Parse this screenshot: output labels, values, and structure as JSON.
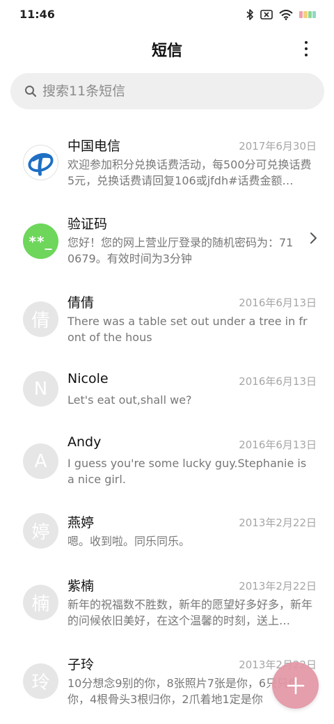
{
  "status_bar": {
    "time": "11:46",
    "icons": [
      "bluetooth-icon",
      "no-sim-icon",
      "wifi-icon",
      "battery-icon"
    ],
    "battery_colors": [
      "#f0a0a8",
      "#f2d080",
      "#8ed88a",
      "#8ed8c8"
    ]
  },
  "header": {
    "title": "短信",
    "more_icon": "more-vertical-icon"
  },
  "search": {
    "placeholder": "搜索11条短信",
    "icon": "search-icon"
  },
  "messages": [
    {
      "sender": "中国电信",
      "date": "2017年6月30日",
      "preview": "欢迎参加积分兑换话费活动，每500分可兑换话费5元，兑换话费请回复106或jfdh#话费金额…",
      "avatar_type": "logo",
      "avatar_icon": "china-telecom-logo-icon"
    },
    {
      "sender": "验证码",
      "date": "",
      "preview": "您好！您的网上营业厅登录的随机密码为：710679。有效时间为3分钟",
      "avatar_type": "code",
      "avatar_text": "**_",
      "avatar_color": "#6dd65b"
    },
    {
      "sender": "倩倩",
      "date": "2016年6月13日",
      "preview": "There was a table set out under a tree in front of the hous",
      "avatar_type": "letter",
      "avatar_text": "倩"
    },
    {
      "sender": "Nicole",
      "date": "2016年6月13日",
      "preview": "Let's eat out,shall we?",
      "avatar_type": "letter",
      "avatar_text": "N"
    },
    {
      "sender": "Andy",
      "date": "2016年6月13日",
      "preview": "I guess you're some lucky guy.Stephanie is a nice girl.",
      "avatar_type": "letter",
      "avatar_text": "A"
    },
    {
      "sender": "燕婷",
      "date": "2013年2月22日",
      "preview": "嗯。收到啦。同乐同乐。",
      "avatar_type": "letter",
      "avatar_text": "婷"
    },
    {
      "sender": "紫楠",
      "date": "2013年2月22日",
      "preview": "新年的祝福数不胜数，新年的愿望好多好多，新年的问候依旧美好，在这个温馨的时刻，送上…",
      "avatar_type": "letter",
      "avatar_text": "楠"
    },
    {
      "sender": "子玲",
      "date": "2013年2月22日",
      "preview": "10分想念9别的你，8张照片7张是你，6只只像你，4根骨头3根归你，2爪着地1定是你",
      "avatar_type": "letter",
      "avatar_text": "玲"
    }
  ],
  "fab": {
    "icon": "plus-icon",
    "color": "#e296a5"
  },
  "colors": {
    "avatar_gray": "#e6e6e6",
    "date_gray": "#a6a6a6",
    "preview_gray": "#777777",
    "search_bg": "#efefef"
  }
}
